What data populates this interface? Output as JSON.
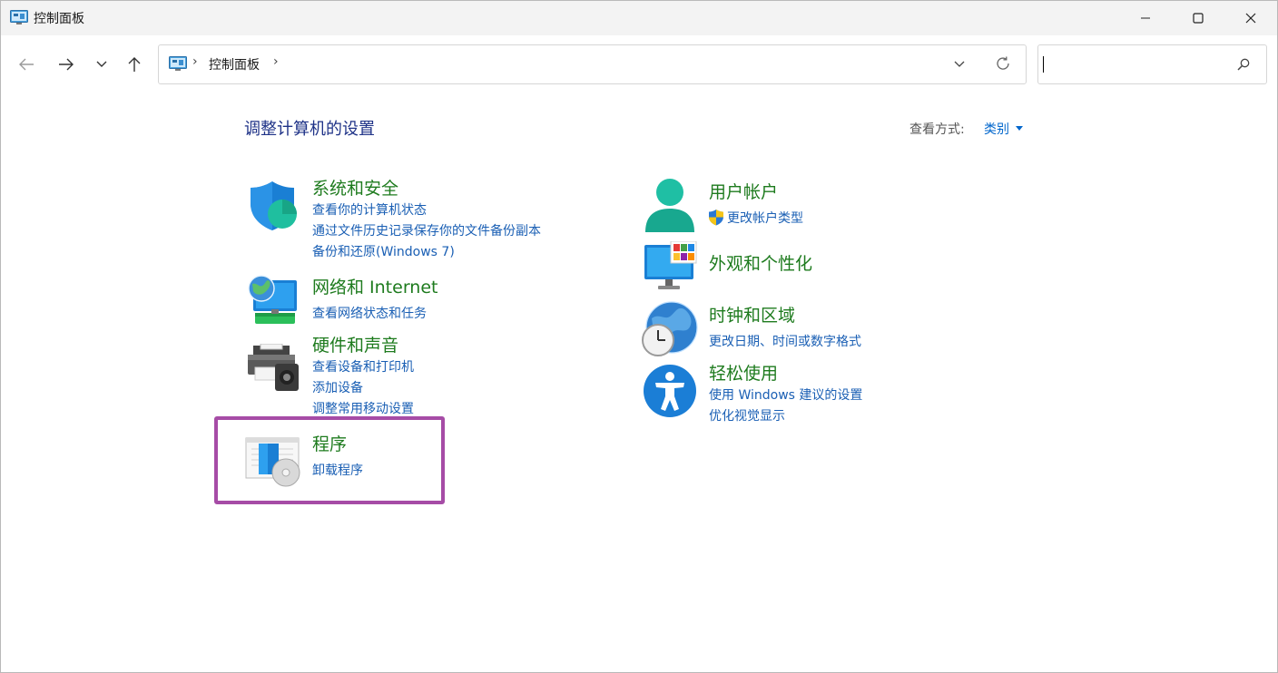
{
  "window": {
    "title": "控制面板"
  },
  "address_bar": {
    "crumb": "控制面板",
    "separator": "›"
  },
  "search": {
    "placeholder": ""
  },
  "header": {
    "page_title": "调整计算机的设置",
    "view_by_label": "查看方式:",
    "view_by_value": "类别"
  },
  "categories": {
    "system_security": {
      "title": "系统和安全",
      "links": [
        "查看你的计算机状态",
        "通过文件历史记录保存你的文件备份副本",
        "备份和还原(Windows 7)"
      ]
    },
    "network": {
      "title": "网络和 Internet",
      "links": [
        "查看网络状态和任务"
      ]
    },
    "hardware": {
      "title": "硬件和声音",
      "links": [
        "查看设备和打印机",
        "添加设备",
        "调整常用移动设置"
      ]
    },
    "programs": {
      "title": "程序",
      "links": [
        "卸载程序"
      ]
    },
    "user_accounts": {
      "title": "用户帐户",
      "links": [
        "更改帐户类型"
      ]
    },
    "appearance": {
      "title": "外观和个性化",
      "links": []
    },
    "clock_region": {
      "title": "时钟和区域",
      "links": [
        "更改日期、时间或数字格式"
      ]
    },
    "ease_of_access": {
      "title": "轻松使用",
      "links": [
        "使用 Windows 建议的设置",
        "优化视觉显示"
      ]
    }
  },
  "colors": {
    "category_title": "#1e7b1e",
    "link": "#1a5fb4",
    "page_title": "#1e3287",
    "highlight": "#a64ca6"
  }
}
